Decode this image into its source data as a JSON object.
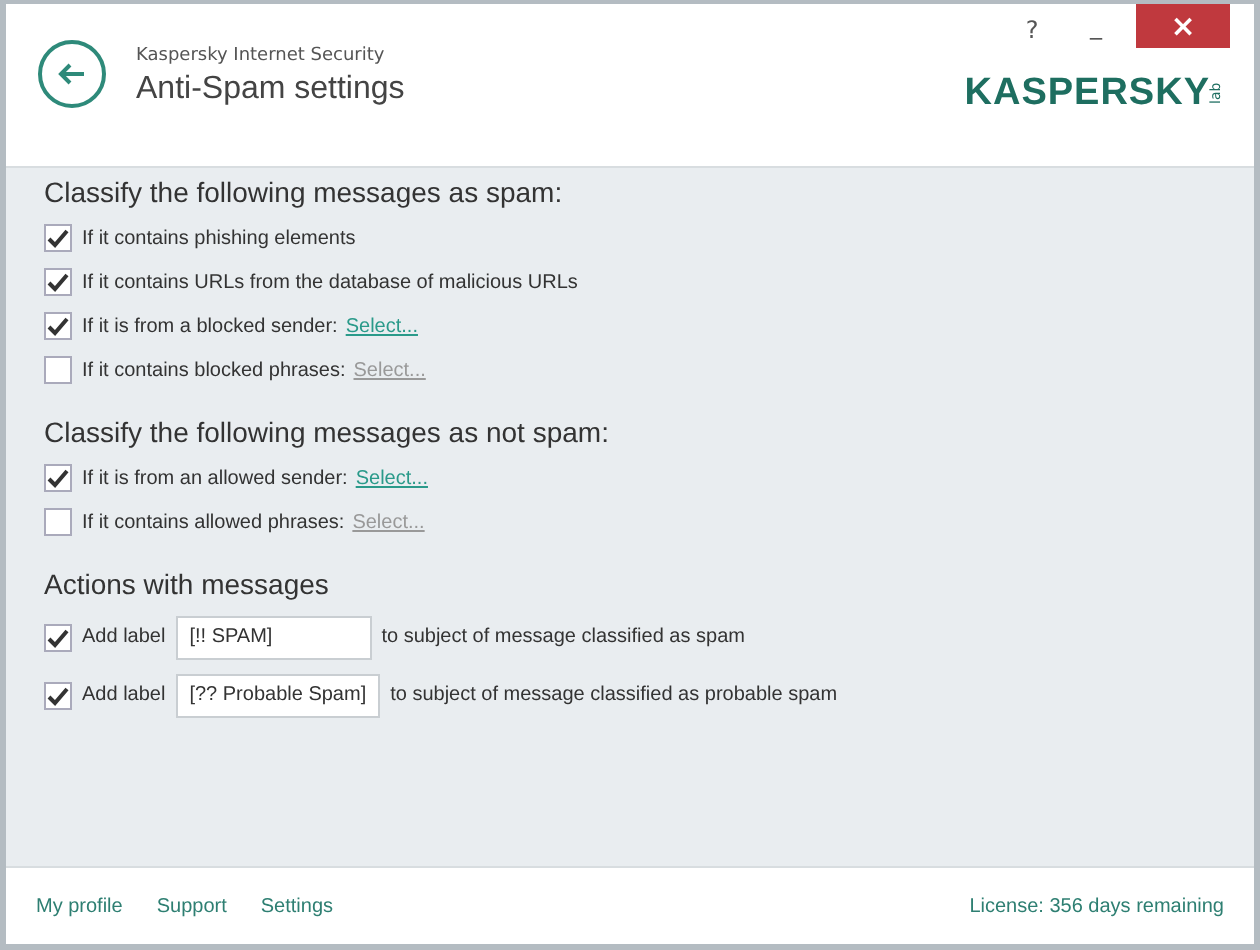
{
  "window": {
    "help": "?",
    "minimize": "_",
    "close": "×"
  },
  "header": {
    "product": "Kaspersky Internet Security",
    "title": "Anti-Spam settings",
    "logo": "KASPERSKY",
    "logo_suffix": "lab"
  },
  "sections": [
    {
      "title": "Classify the following messages as spam:",
      "options": [
        {
          "kind": "plain",
          "label": "If it contains phishing elements",
          "checked": true
        },
        {
          "kind": "plain",
          "label": "If it contains URLs from the database of malicious URLs",
          "checked": true
        },
        {
          "kind": "link",
          "label": "If it is from a blocked sender:",
          "link": "Select...",
          "checked": true
        },
        {
          "kind": "link",
          "label": "If it contains blocked phrases:",
          "link": "Select...",
          "checked": false
        }
      ]
    },
    {
      "title": "Classify the following messages as not spam:",
      "options": [
        {
          "kind": "link",
          "label": "If it is from an allowed sender:",
          "link": "Select...",
          "checked": true
        },
        {
          "kind": "link",
          "label": "If it contains allowed phrases:",
          "link": "Select...",
          "checked": false
        }
      ]
    },
    {
      "title": "Actions with messages",
      "options": [
        {
          "kind": "field",
          "label": "Add label",
          "value": "[!! SPAM]",
          "suffix": "to subject of message classified as spam",
          "checked": true
        },
        {
          "kind": "field",
          "label": "Add label",
          "value": "[?? Probable Spam]",
          "suffix": "to subject of message classified as probable spam",
          "checked": true
        }
      ]
    }
  ],
  "footer": {
    "links": [
      "My profile",
      "Support",
      "Settings"
    ],
    "license": "License: 356 days remaining"
  }
}
